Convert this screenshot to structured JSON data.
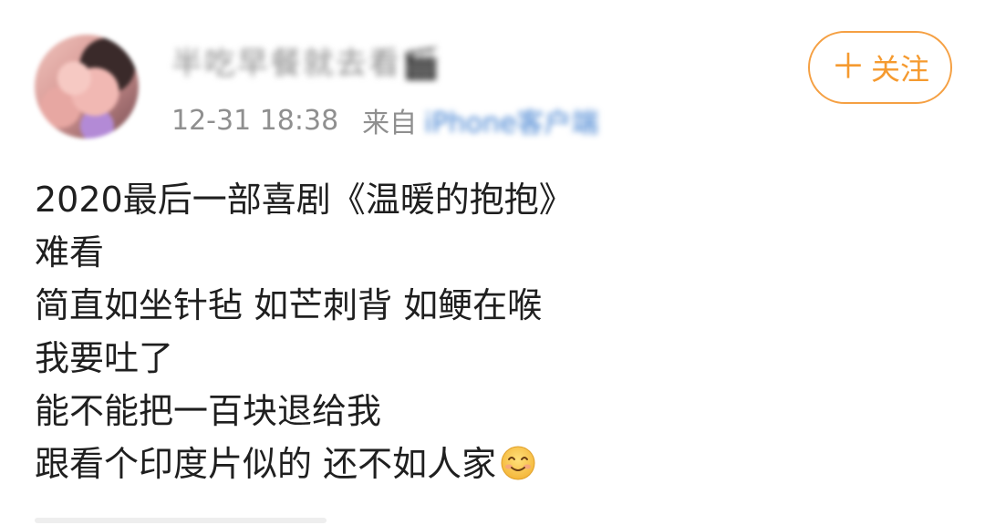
{
  "post": {
    "username": "半吃早餐就去看🎬",
    "time": "12-31 18:38",
    "from_label": "来自",
    "source": "iPhone客户端",
    "follow_button": {
      "icon": "plus-icon",
      "label": "关注"
    },
    "content_lines": [
      "2020最后一部喜剧《温暖的抱抱》",
      "难看",
      "简直如坐针毡 如芒刺背 如鲠在喉",
      "我要吐了",
      "能不能把一百块退给我",
      "跟看个印度片似的 还不如人家"
    ],
    "trailing_emoji": "smiling-face-emoji"
  },
  "colors": {
    "accent_orange": "#f59a2f",
    "meta_gray": "#8f8f8f",
    "text": "#1f1f1f",
    "link_blue": "#3f7fd0"
  }
}
